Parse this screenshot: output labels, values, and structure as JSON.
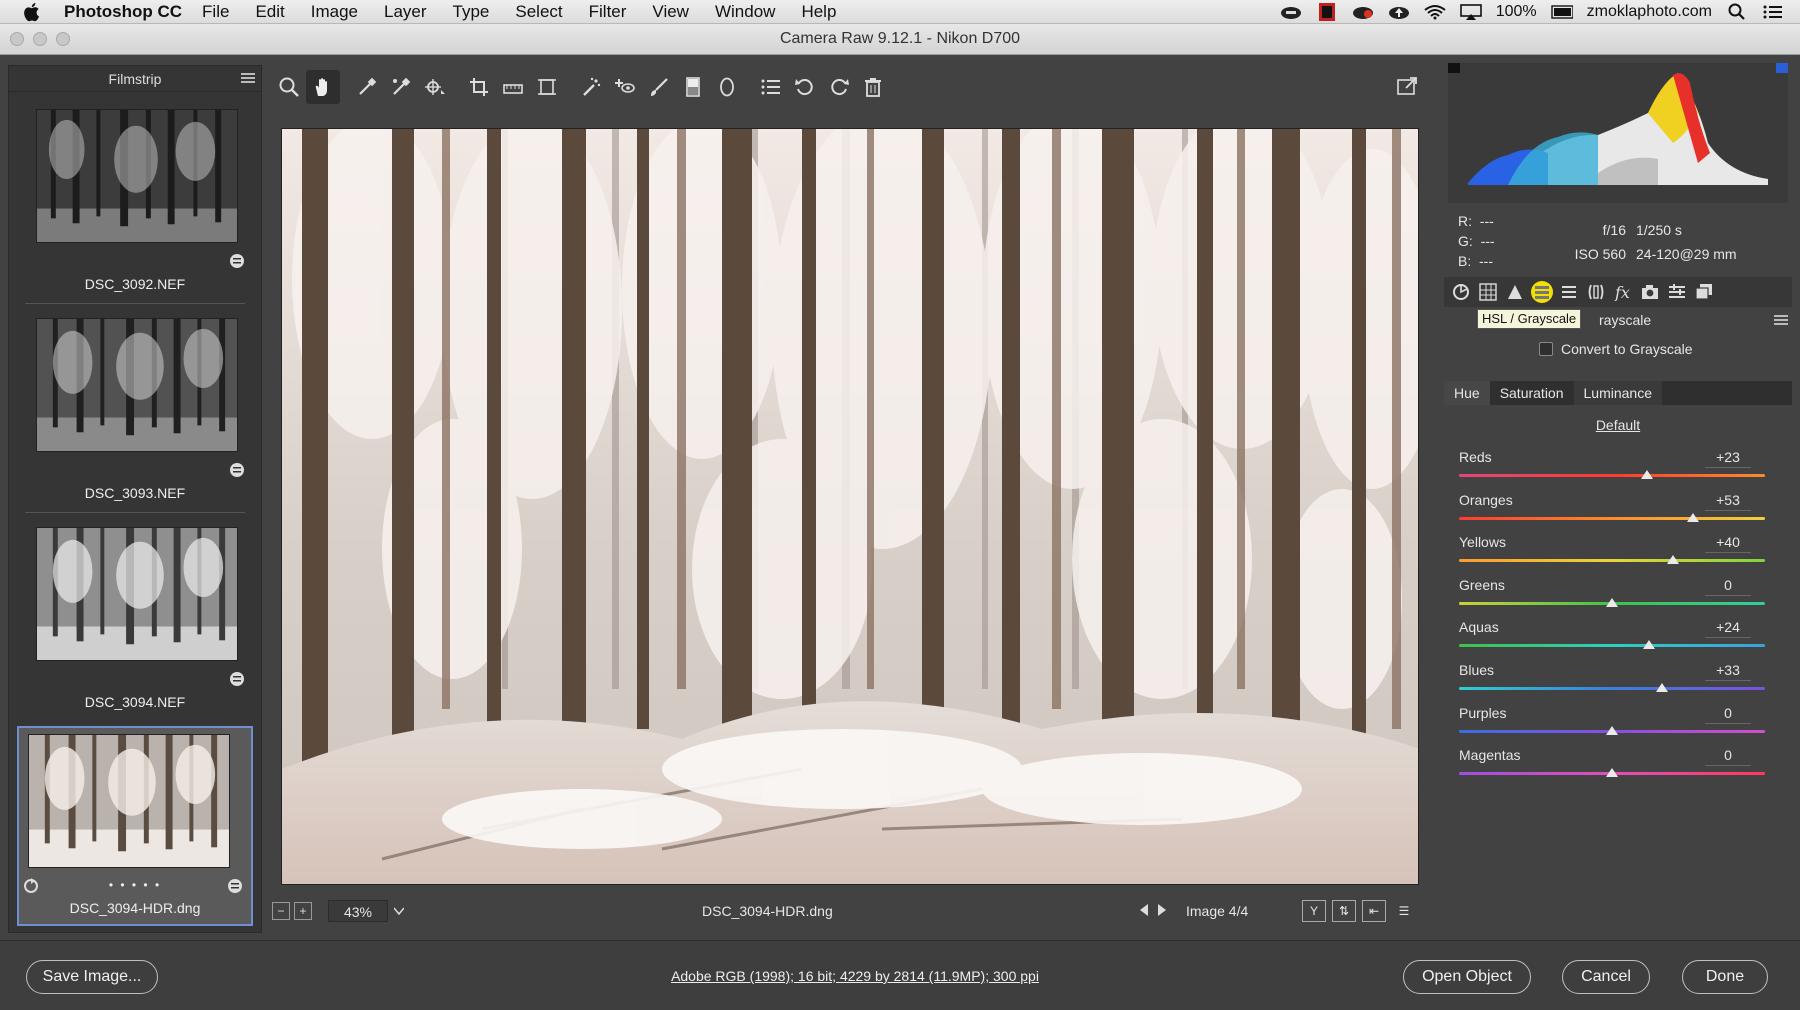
{
  "menubar": {
    "app_name": "Photoshop CC",
    "items": [
      "File",
      "Edit",
      "Image",
      "Layer",
      "Type",
      "Select",
      "Filter",
      "View",
      "Window",
      "Help"
    ],
    "battery": "100%",
    "account": "zmoklaphoto.com"
  },
  "window": {
    "title": "Camera Raw 9.12.1  -  Nikon D700"
  },
  "filmstrip": {
    "title": "Filmstrip",
    "items": [
      {
        "label": "DSC_3092.NEF"
      },
      {
        "label": "DSC_3093.NEF"
      },
      {
        "label": "DSC_3094.NEF"
      },
      {
        "label": "DSC_3094-HDR.dng",
        "selected": true,
        "rating_dots": "• • • • •"
      }
    ]
  },
  "toolbar": {
    "tools": [
      "zoom-tool-icon",
      "hand-tool-icon",
      "white-balance-tool-icon",
      "color-sampler-tool-icon",
      "targeted-adjustment-tool-icon",
      "crop-tool-icon",
      "straighten-tool-icon",
      "transform-tool-icon",
      "spot-removal-tool-icon",
      "red-eye-removal-icon",
      "adjustment-brush-icon",
      "graduated-filter-icon",
      "radial-filter-icon",
      "preferences-icon",
      "rotate-ccw-icon",
      "rotate-cw-icon",
      "trash-icon"
    ],
    "active_tool": "hand-tool-icon"
  },
  "preview": {
    "zoom": "43%",
    "filename": "DSC_3094-HDR.dng",
    "image_count": "Image 4/4"
  },
  "info": {
    "r_label": "R:",
    "r_value": "---",
    "g_label": "G:",
    "g_value": "---",
    "b_label": "B:",
    "b_value": "---",
    "aperture": "f/16",
    "shutter": "1/250 s",
    "iso": "ISO 560",
    "lens": "24-120@29 mm"
  },
  "panel": {
    "tooltip": "HSL / Grayscale",
    "title_visible": "rayscale",
    "convert_label": "Convert to Grayscale",
    "subtabs": [
      "Hue",
      "Saturation",
      "Luminance"
    ],
    "active_subtab": "Hue",
    "default_link": "Default",
    "sliders": [
      {
        "label": "Reds",
        "value": "+23",
        "num": 23,
        "colors": [
          "#e0487b",
          "#ff3a2e",
          "#ff8b2b"
        ]
      },
      {
        "label": "Oranges",
        "value": "+53",
        "num": 53,
        "colors": [
          "#ff3a2e",
          "#ff8b2b",
          "#f1d13c"
        ]
      },
      {
        "label": "Yellows",
        "value": "+40",
        "num": 40,
        "colors": [
          "#ff9a2b",
          "#e8d43a",
          "#7fd43e"
        ]
      },
      {
        "label": "Greens",
        "value": "0",
        "num": 0,
        "colors": [
          "#c8d23a",
          "#3fc24a",
          "#2fcf9a"
        ]
      },
      {
        "label": "Aquas",
        "value": "+24",
        "num": 24,
        "colors": [
          "#3fc24a",
          "#2fcfbf",
          "#3aa0e0"
        ]
      },
      {
        "label": "Blues",
        "value": "+33",
        "num": 33,
        "colors": [
          "#2fcfcf",
          "#3a7fe0",
          "#7b52e0"
        ]
      },
      {
        "label": "Purples",
        "value": "0",
        "num": 0,
        "colors": [
          "#3a6fe0",
          "#8a4fe0",
          "#d34fc8"
        ]
      },
      {
        "label": "Magentas",
        "value": "0",
        "num": 0,
        "colors": [
          "#a04fe0",
          "#e04fb8",
          "#ff3a5a"
        ]
      }
    ]
  },
  "bottom": {
    "save_label": "Save Image...",
    "workflow": "Adobe RGB (1998); 16 bit; 4229 by 2814 (11.9MP); 300 ppi",
    "open_label": "Open Object",
    "cancel_label": "Cancel",
    "done_label": "Done"
  }
}
